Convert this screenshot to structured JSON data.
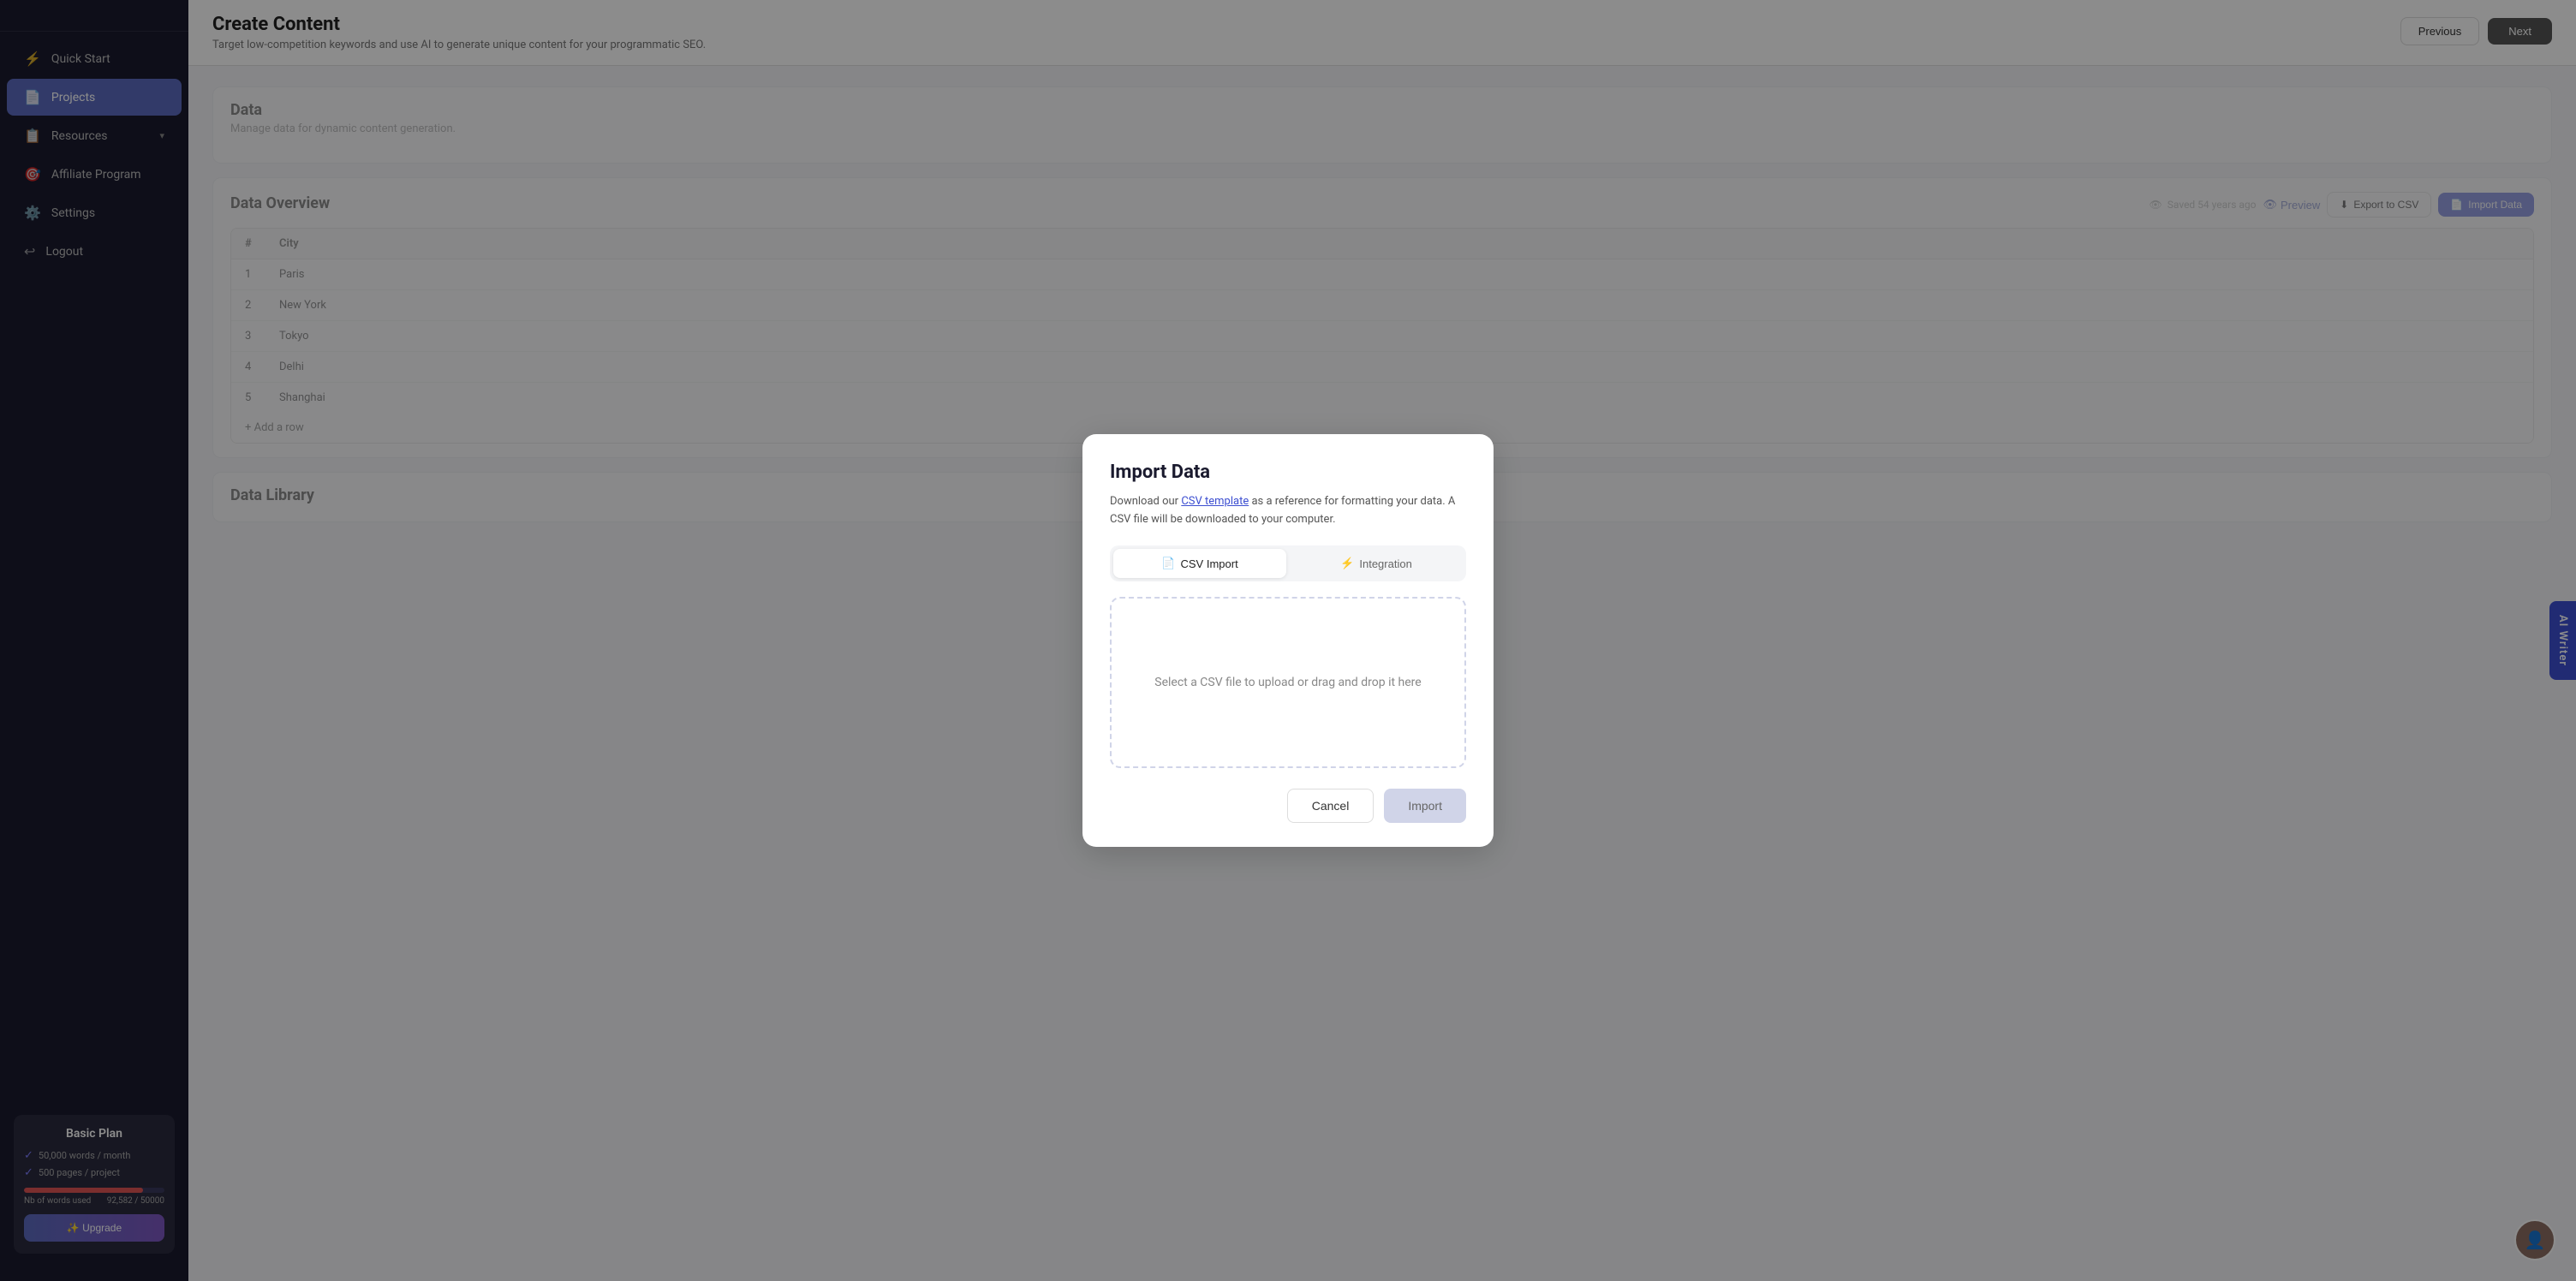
{
  "sidebar": {
    "items": [
      {
        "id": "quick-start",
        "label": "Quick Start",
        "icon": "⚡",
        "active": false
      },
      {
        "id": "projects",
        "label": "Projects",
        "icon": "📄",
        "active": true
      },
      {
        "id": "resources",
        "label": "Resources",
        "icon": "📋",
        "active": false,
        "hasArrow": true
      },
      {
        "id": "affiliate",
        "label": "Affiliate Program",
        "icon": "🎯",
        "active": false
      },
      {
        "id": "settings",
        "label": "Settings",
        "icon": "⚙️",
        "active": false
      },
      {
        "id": "logout",
        "label": "Logout",
        "icon": "↩",
        "active": false
      }
    ],
    "plan": {
      "title": "Basic Plan",
      "features": [
        "50,000 words / month",
        "500 pages / project"
      ],
      "words_used_label": "Nb of words used",
      "words_used_value": "92,582 / 50000",
      "progress_pct": 85,
      "upgrade_label": "✨ Upgrade"
    }
  },
  "header": {
    "title": "Create Content",
    "description": "Target low-competition keywords and use AI to generate unique content for your programmatic SEO.",
    "prev_label": "Previous",
    "next_label": "Next",
    "saved_label": "Saved 54 years ago",
    "preview_label": "Preview"
  },
  "data_section": {
    "title": "Data",
    "description": "Manage data for dynamic content generation.",
    "overview_title": "Data Overview",
    "export_label": "Export to CSV",
    "import_label": "Import Data",
    "table": {
      "column": "City",
      "rows": [
        {
          "num": 1,
          "value": "Paris"
        },
        {
          "num": 2,
          "value": "New York"
        },
        {
          "num": 3,
          "value": "Tokyo"
        },
        {
          "num": 4,
          "value": "Delhi"
        },
        {
          "num": 5,
          "value": "Shanghai"
        }
      ],
      "add_row": "+ Add a row"
    }
  },
  "data_library": {
    "title": "Data Library"
  },
  "ai_writer": {
    "label": "AI Writer"
  },
  "modal": {
    "title": "Import Data",
    "description_before": "Download our ",
    "csv_template_link": "CSV template",
    "description_after": " as a reference for formatting your data. A CSV file will be downloaded to your computer.",
    "tabs": [
      {
        "id": "csv-import",
        "label": "CSV Import",
        "icon": "📄",
        "active": true
      },
      {
        "id": "integration",
        "label": "Integration",
        "icon": "⚡",
        "active": false
      }
    ],
    "drop_zone_label": "Select a CSV file to upload or drag and drop it here",
    "cancel_label": "Cancel",
    "import_label": "Import"
  }
}
